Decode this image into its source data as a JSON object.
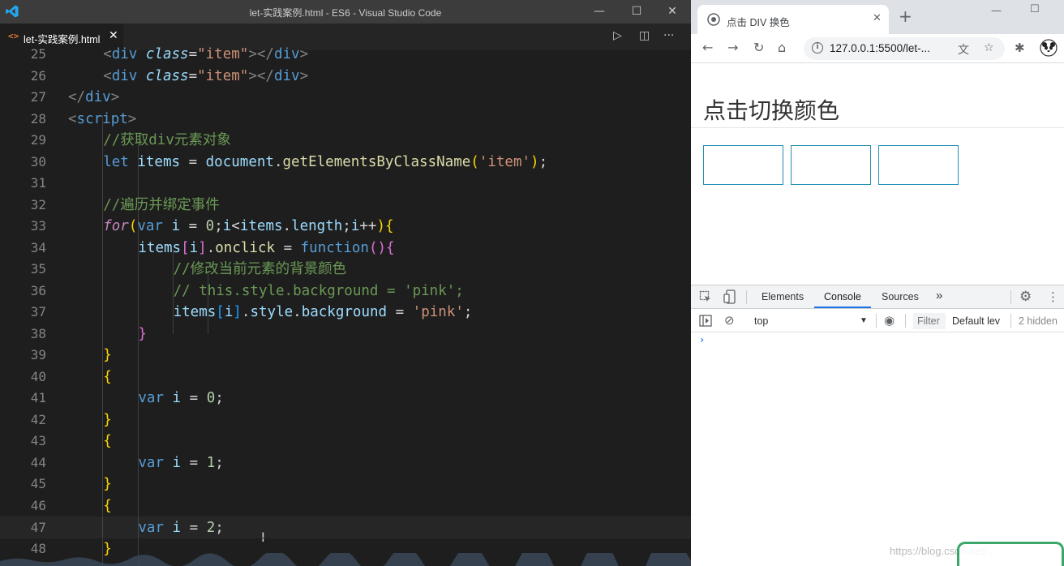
{
  "vscode": {
    "title": "let-实践案例.html - ES6 - Visual Studio Code",
    "tab": {
      "icon": "<>",
      "label": "let-实践案例.html",
      "close": "✕"
    },
    "window_controls": {
      "minimize": "—",
      "maximize": "☐",
      "close": "✕"
    },
    "tab_actions": {
      "run": "▷",
      "split": "◫",
      "more": "···"
    }
  },
  "lines": [
    {
      "n": "25",
      "tokens": [
        [
          "k-pun",
          "<"
        ],
        [
          "k-tag",
          "div"
        ],
        [
          "k-pl",
          " "
        ],
        [
          "k-attr",
          "class"
        ],
        [
          "k-pl",
          "="
        ],
        [
          "k-str",
          "\"item\""
        ],
        [
          "k-pun",
          "></"
        ],
        [
          "k-tag",
          "div"
        ],
        [
          "k-pun",
          ">"
        ]
      ]
    },
    {
      "n": "26",
      "tokens": [
        [
          "k-pun",
          "<"
        ],
        [
          "k-tag",
          "div"
        ],
        [
          "k-pl",
          " "
        ],
        [
          "k-attr",
          "class"
        ],
        [
          "k-pl",
          "="
        ],
        [
          "k-str",
          "\"item\""
        ],
        [
          "k-pun",
          "></"
        ],
        [
          "k-tag",
          "div"
        ],
        [
          "k-pun",
          ">"
        ]
      ]
    },
    {
      "n": "27",
      "tokens": [
        [
          "k-pun",
          "</"
        ],
        [
          "k-tag",
          "div"
        ],
        [
          "k-pun",
          ">"
        ]
      ]
    },
    {
      "n": "28",
      "tokens": [
        [
          "k-pun",
          "<"
        ],
        [
          "k-tag",
          "script"
        ],
        [
          "k-pun",
          ">"
        ]
      ]
    },
    {
      "n": "29",
      "tokens": [
        [
          "k-cm",
          "//获取div元素对象"
        ]
      ]
    },
    {
      "n": "30",
      "tokens": [
        [
          "k-kw",
          "let"
        ],
        [
          "k-pl",
          " "
        ],
        [
          "k-var",
          "items"
        ],
        [
          "k-pl",
          " = "
        ],
        [
          "k-var",
          "document"
        ],
        [
          "k-pl",
          "."
        ],
        [
          "k-fn",
          "getElementsByClassName"
        ],
        [
          "k-yel",
          "("
        ],
        [
          "k-str",
          "'item'"
        ],
        [
          "k-yel",
          ")"
        ],
        [
          "k-pl",
          ";"
        ]
      ]
    },
    {
      "n": "31",
      "tokens": []
    },
    {
      "n": "32",
      "tokens": [
        [
          "k-cm",
          "//遍历并绑定事件"
        ]
      ]
    },
    {
      "n": "33",
      "tokens": [
        [
          "k-ctl",
          "for"
        ],
        [
          "k-yel",
          "("
        ],
        [
          "k-kw",
          "var"
        ],
        [
          "k-pl",
          " "
        ],
        [
          "k-var",
          "i"
        ],
        [
          "k-pl",
          " = "
        ],
        [
          "k-num",
          "0"
        ],
        [
          "k-pl",
          ";"
        ],
        [
          "k-var",
          "i"
        ],
        [
          "k-pl",
          "<"
        ],
        [
          "k-var",
          "items"
        ],
        [
          "k-pl",
          "."
        ],
        [
          "k-var",
          "length"
        ],
        [
          "k-pl",
          ";"
        ],
        [
          "k-var",
          "i"
        ],
        [
          "k-pl",
          "++"
        ],
        [
          "k-yel",
          "){"
        ]
      ]
    },
    {
      "n": "34",
      "tokens": [
        [
          "k-var",
          "items"
        ],
        [
          "k-pnk",
          "["
        ],
        [
          "k-var",
          "i"
        ],
        [
          "k-pnk",
          "]"
        ],
        [
          "k-pl",
          "."
        ],
        [
          "k-fn",
          "onclick"
        ],
        [
          "k-pl",
          " = "
        ],
        [
          "k-kw",
          "function"
        ],
        [
          "k-pnk",
          "(){"
        ]
      ]
    },
    {
      "n": "35",
      "tokens": [
        [
          "k-cm",
          "//修改当前元素的背景颜色"
        ]
      ]
    },
    {
      "n": "36",
      "tokens": [
        [
          "k-cm",
          "// this.style.background = 'pink';"
        ]
      ]
    },
    {
      "n": "37",
      "tokens": [
        [
          "k-var",
          "items"
        ],
        [
          "k-blu2",
          "["
        ],
        [
          "k-var",
          "i"
        ],
        [
          "k-blu2",
          "]"
        ],
        [
          "k-pl",
          "."
        ],
        [
          "k-var",
          "style"
        ],
        [
          "k-pl",
          "."
        ],
        [
          "k-var",
          "background"
        ],
        [
          "k-pl",
          " = "
        ],
        [
          "k-str",
          "'pink'"
        ],
        [
          "k-pl",
          ";"
        ]
      ]
    },
    {
      "n": "38",
      "tokens": [
        [
          "k-pnk",
          "}"
        ]
      ]
    },
    {
      "n": "39",
      "tokens": [
        [
          "k-yel",
          "}"
        ]
      ]
    },
    {
      "n": "40",
      "tokens": [
        [
          "k-yel",
          "{"
        ]
      ]
    },
    {
      "n": "41",
      "tokens": [
        [
          "k-kw",
          "var"
        ],
        [
          "k-pl",
          " "
        ],
        [
          "k-var",
          "i"
        ],
        [
          "k-pl",
          " = "
        ],
        [
          "k-num",
          "0"
        ],
        [
          "k-pl",
          ";"
        ]
      ]
    },
    {
      "n": "42",
      "tokens": [
        [
          "k-yel",
          "}"
        ]
      ]
    },
    {
      "n": "43",
      "tokens": [
        [
          "k-yel",
          "{"
        ]
      ]
    },
    {
      "n": "44",
      "tokens": [
        [
          "k-kw",
          "var"
        ],
        [
          "k-pl",
          " "
        ],
        [
          "k-var",
          "i"
        ],
        [
          "k-pl",
          " = "
        ],
        [
          "k-num",
          "1"
        ],
        [
          "k-pl",
          ";"
        ]
      ]
    },
    {
      "n": "45",
      "tokens": [
        [
          "k-yel",
          "}"
        ]
      ]
    },
    {
      "n": "46",
      "tokens": [
        [
          "k-yel",
          "{"
        ]
      ]
    },
    {
      "n": "47",
      "tokens": [
        [
          "k-kw",
          "var"
        ],
        [
          "k-pl",
          " "
        ],
        [
          "k-var",
          "i"
        ],
        [
          "k-pl",
          " = "
        ],
        [
          "k-num",
          "2"
        ],
        [
          "k-pl",
          ";"
        ]
      ]
    },
    {
      "n": "48",
      "tokens": [
        [
          "k-yel",
          "}"
        ]
      ]
    }
  ],
  "chrome": {
    "tab_title": "点击 DIV 换色",
    "tab_close": "✕",
    "new_tab": "+",
    "url": "127.0.0.1:5500/let-...",
    "nav": {
      "back": "←",
      "forward": "→",
      "reload": "↻",
      "home": "⌂"
    },
    "omnibox_icons": {
      "translate": "文",
      "star": "☆"
    },
    "toolbar_icons": {
      "extensions": "✱"
    },
    "window_controls": {
      "minimize": "—",
      "maximize": "☐"
    }
  },
  "page": {
    "heading": "点击切换颜色"
  },
  "devtools": {
    "tabs": [
      "Elements",
      "Console",
      "Sources"
    ],
    "more_tabs": "»",
    "context": "top",
    "filter": "Filter",
    "level": "Default lev",
    "hidden": "2 hidden",
    "prompt": "›",
    "icons": {
      "gear": "⚙",
      "more": "⋮",
      "eye": "◉",
      "clear": "⊘",
      "sidebar": "▶"
    }
  },
  "watermark": "https://blog.csdn.net/..."
}
